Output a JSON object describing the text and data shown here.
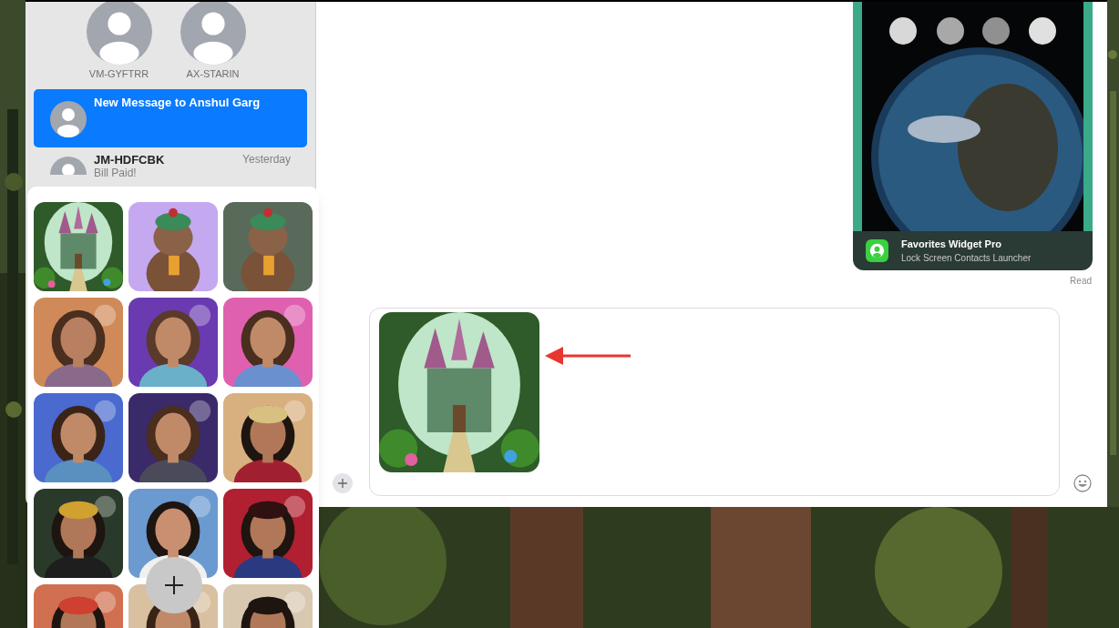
{
  "pinned": [
    {
      "name": "VM-GYFTRR"
    },
    {
      "name": "AX-STARIN"
    }
  ],
  "conversations": [
    {
      "title": "New Message to Anshul Garg",
      "selected": true
    },
    {
      "title": "JM-HDFCBK",
      "time": "Yesterday",
      "preview": "Bill Paid!",
      "selected": false
    }
  ],
  "message": {
    "app_title": "Favorites Widget Pro",
    "app_subtitle": "Lock Screen Contacts Launcher",
    "status": "Read"
  },
  "sticker_popover": {
    "open": true
  }
}
